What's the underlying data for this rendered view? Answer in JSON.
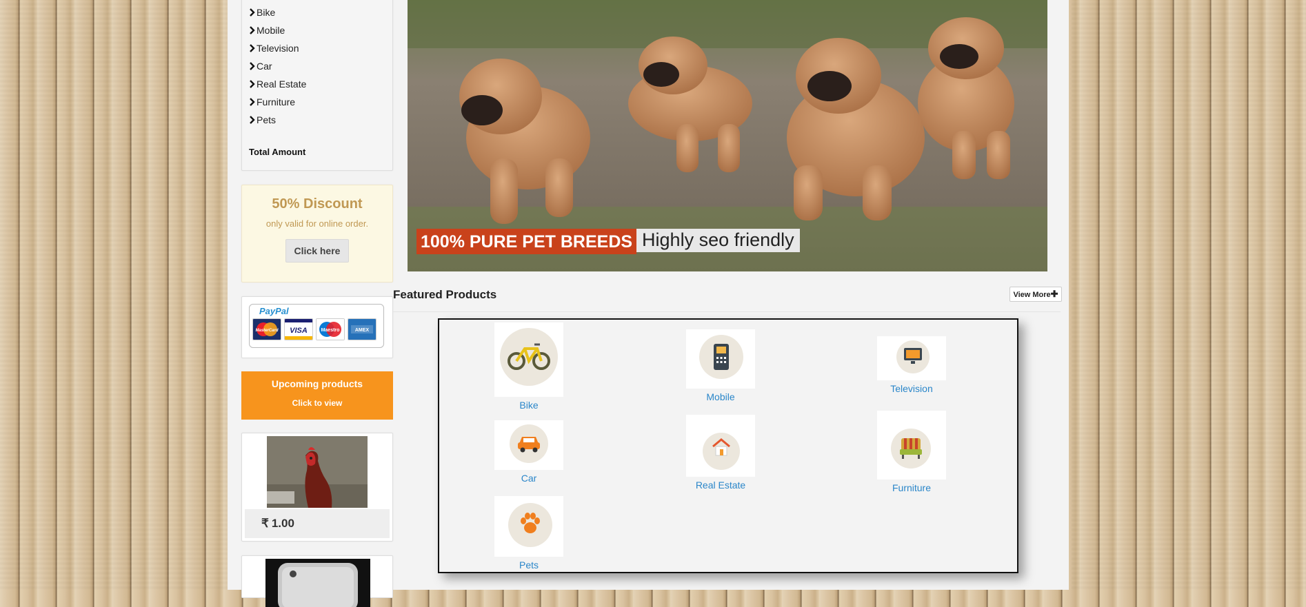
{
  "sidebar": {
    "categories": [
      "Bike",
      "Mobile",
      "Television",
      "Car",
      "Real Estate",
      "Furniture",
      "Pets"
    ],
    "total_label": "Total Amount"
  },
  "discount": {
    "title": "50% Discount",
    "subtitle": "only valid for online order.",
    "button": "Click here"
  },
  "payment": {
    "brand": "PayPal",
    "cards": [
      "MasterCard",
      "VISA",
      "Maestro",
      "AMEX"
    ]
  },
  "upcoming": {
    "title": "Upcoming products",
    "subtitle": "Click to view"
  },
  "product": {
    "currency": "₹",
    "price": "1.00"
  },
  "banner": {
    "caption_main": "100% PURE PET BREEDS",
    "caption_sub": "Highly seo friendly"
  },
  "featured": {
    "title": "Featured Products",
    "view_more": "View More",
    "items": [
      "Bike",
      "Mobile",
      "Television",
      "Car",
      "Real Estate",
      "Furniture",
      "Pets"
    ]
  },
  "colors": {
    "accent_orange": "#f7941d",
    "caption_red": "#c9421b",
    "link_blue": "#2a86c9",
    "discount_text": "#c09853"
  }
}
